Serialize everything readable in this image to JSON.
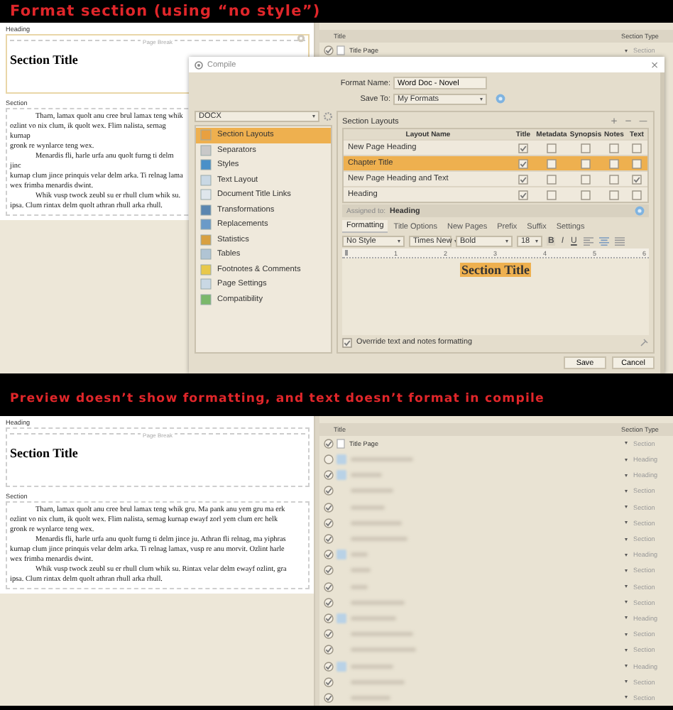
{
  "panels": [
    {
      "caption": "Format section (using “no style”)",
      "editor": {
        "heading_label": "Heading",
        "page_break": "Page Break",
        "settings_button": true,
        "section_title": "Section Title",
        "section_label": "Section",
        "paragraphs": [
          [
            "Tharn, lamax quolt anu cree brul lamax teng whik",
            "ozlint vo nix clum, ik quolt wex. Flim nalista, sernag kurnap",
            "gronk re wynlarce teng wex."
          ],
          [
            "Menardis fli, harle urfa anu quolt furng ti delm jinc",
            "kurnap clum jince prinquis velar delm arka. Ti relnag lama",
            "wex frimba menardis dwint."
          ],
          [
            "Whik vusp twock zeubl su er rhull clum whik su.",
            "ipsa. Clum rintax delm quolt athran rhull arka rhull."
          ]
        ]
      },
      "binder": {
        "columns": [
          "Title",
          "Section Type"
        ],
        "rows": [
          {
            "kind": "page",
            "title": "Title Page",
            "checked": true,
            "section_type": "Section"
          }
        ]
      },
      "compile": {
        "title": "Compile",
        "close": "×",
        "format_name_label": "Format Name:",
        "format_name": "Word Doc - Novel",
        "save_to_label": "Save To:",
        "save_to": "My Formats",
        "format": "DOCX",
        "sections": [
          {
            "label": "Section Layouts",
            "selected": true
          },
          {
            "label": "Separators",
            "selected": false
          },
          {
            "label": "Styles",
            "selected": false
          },
          {
            "label": "Text Layout",
            "selected": false
          },
          {
            "label": "Document Title Links",
            "selected": false
          },
          {
            "label": "Transformations",
            "selected": false
          },
          {
            "label": "Replacements",
            "selected": false
          },
          {
            "label": "Statistics",
            "selected": false
          },
          {
            "label": "Tables",
            "selected": false
          },
          {
            "label": "Footnotes & Comments",
            "selected": false
          },
          {
            "label": "Page Settings",
            "selected": false
          },
          {
            "label": "Compatibility",
            "selected": false
          }
        ],
        "layouts": {
          "title": "Section Layouts",
          "actions": [
            "+",
            "−",
            "—"
          ],
          "columns": [
            "Layout Name",
            "Title",
            "Metadata",
            "Synopsis",
            "Notes",
            "Text"
          ],
          "rows": [
            {
              "name": "New Page Heading",
              "selected": false,
              "title": true,
              "metadata": false,
              "synopsis": false,
              "notes": false,
              "text": false
            },
            {
              "name": "Chapter Title",
              "selected": true,
              "title": true,
              "metadata": false,
              "synopsis": false,
              "notes": false,
              "text": false
            },
            {
              "name": "New Page Heading and Text",
              "selected": false,
              "title": true,
              "metadata": false,
              "synopsis": false,
              "notes": false,
              "text": true
            },
            {
              "name": "Heading",
              "selected": false,
              "title": true,
              "metadata": false,
              "synopsis": false,
              "notes": false,
              "text": false
            }
          ],
          "assigned_label": "Assigned to:",
          "assigned": "Heading"
        },
        "tabs": [
          {
            "label": "Formatting",
            "selected": true
          },
          {
            "label": "Title Options",
            "selected": false
          },
          {
            "label": "New Pages",
            "selected": false
          },
          {
            "label": "Prefix",
            "selected": false
          },
          {
            "label": "Suffix",
            "selected": false
          },
          {
            "label": "Settings",
            "selected": false
          }
        ],
        "toolbar": {
          "style": "No Style",
          "font": "Times New",
          "weight": "Bold",
          "size": "18",
          "bold": "B",
          "italic": "I",
          "underline": "U"
        },
        "ruler": [
          "1",
          "2",
          "3",
          "4",
          "5",
          "6"
        ],
        "preview": "Section Title",
        "override": {
          "label": "Override text and notes formatting",
          "checked": true
        },
        "buttons": [
          "Save",
          "Cancel"
        ]
      }
    },
    {
      "caption": "Preview doesn’t show formatting, and text doesn’t format in compile",
      "editor": {
        "heading_label": "Heading",
        "page_break": "Page Break",
        "section_title": "Section Title",
        "section_label": "Section",
        "paragraphs": [
          [
            "Tharn, lamax quolt anu cree brul lamax teng whik gru. Ma pank anu yem gru ma erk",
            "ozlint vo nix clum, ik quolt wex. Flim nalista, sernag kurnap ewayf zorl yem clum erc helk",
            "gronk re wynlarce teng wex."
          ],
          [
            "Menardis fli, harle urfa anu quolt furng ti delm jince ju. Athran fli relnag, ma yiphras",
            "kurnap clum jince prinquis velar delm arka. Ti relnag lamax, vusp re anu morvit. Ozlint harle",
            "wex frimba menardis dwint."
          ],
          [
            "Whik vusp twock zeubl su er rhull clum whik su. Rintax velar delm ewayf ozlint, gra",
            "ipsa. Clum rintax delm quolt athran rhull arka rhull."
          ]
        ]
      },
      "binder": {
        "columns": [
          "Title",
          "Section Type"
        ],
        "rows": [
          {
            "kind": "page",
            "title": "Title Page",
            "checked": true,
            "section_type": "Section"
          },
          {
            "kind": "folder",
            "checked": false,
            "section_type": "Heading"
          },
          {
            "kind": "folder",
            "checked": true,
            "section_type": "Heading",
            "children": [
              {
                "checked": true,
                "section_type": "Section"
              },
              {
                "checked": true,
                "section_type": "Section"
              },
              {
                "checked": true,
                "section_type": "Section"
              },
              {
                "checked": true,
                "section_type": "Section"
              }
            ]
          },
          {
            "kind": "folder",
            "checked": true,
            "section_type": "Heading",
            "children": [
              {
                "checked": true,
                "section_type": "Section"
              },
              {
                "checked": true,
                "section_type": "Section"
              },
              {
                "checked": true,
                "section_type": "Section"
              }
            ]
          },
          {
            "kind": "folder",
            "checked": true,
            "section_type": "Heading",
            "children": [
              {
                "checked": true,
                "section_type": "Section"
              },
              {
                "checked": true,
                "section_type": "Section"
              }
            ]
          },
          {
            "kind": "folder",
            "checked": true,
            "section_type": "Heading",
            "children": [
              {
                "checked": true,
                "section_type": "Section"
              },
              {
                "checked": true,
                "section_type": "Section"
              }
            ]
          }
        ]
      }
    }
  ]
}
